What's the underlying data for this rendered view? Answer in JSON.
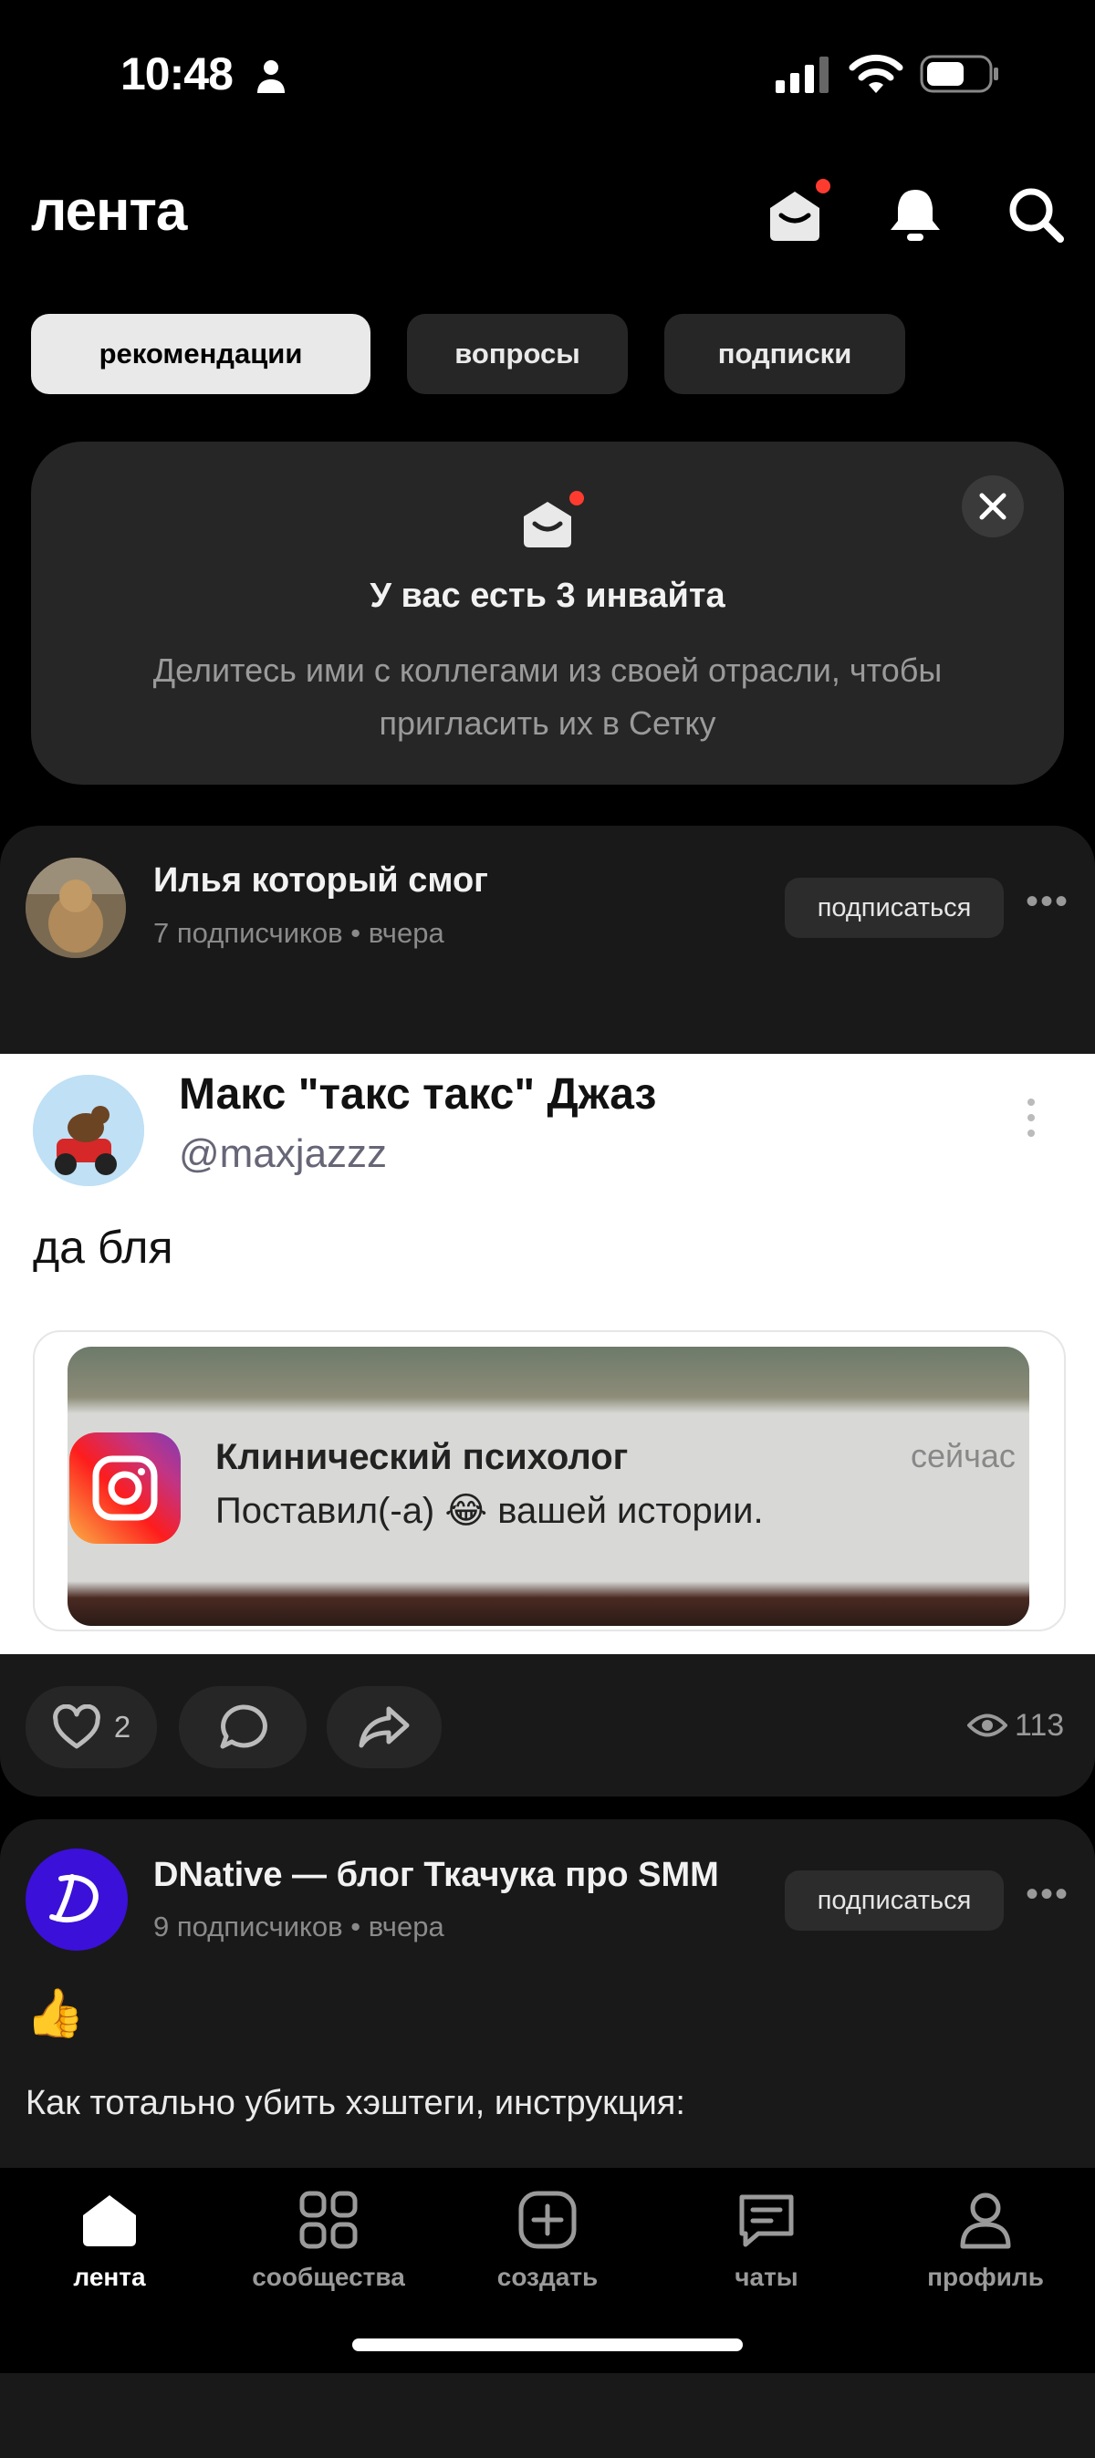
{
  "status_bar": {
    "time": "10:48"
  },
  "header": {
    "title": "лента"
  },
  "tabs": [
    {
      "label": "рекомендации",
      "active": true
    },
    {
      "label": "вопросы",
      "active": false
    },
    {
      "label": "подписки",
      "active": false
    }
  ],
  "invite_card": {
    "title": "У вас есть 3 инвайта",
    "text": "Делитесь ими с коллегами из своей отрасли, чтобы пригласить их в Сетку"
  },
  "posts": [
    {
      "author": "Илья который смог",
      "subscribers": "7 подписчиков",
      "time": "вчера",
      "subscribe_label": "подписаться",
      "embedded": {
        "name": "Макс \"такс такс\" Джаз",
        "handle": "@maxjazzz",
        "text": "да бля",
        "notification_title": "Клинический психолог",
        "notification_time": "сейчас",
        "notification_text": "Поставил(-а) 😂 вашей истории."
      },
      "likes": "2",
      "views": "113"
    },
    {
      "author": "DNative — блог Ткачука про SMM",
      "subscribers": "9 подписчиков",
      "time": "вчера",
      "subscribe_label": "подписаться",
      "emoji": "👍",
      "text": "Как тотально убить хэштеги, инструкция:"
    }
  ],
  "bottom_nav": [
    {
      "label": "лента",
      "icon": "home-icon",
      "active": true
    },
    {
      "label": "сообщества",
      "icon": "grid-icon",
      "active": false
    },
    {
      "label": "создать",
      "icon": "plus-square-icon",
      "active": false
    },
    {
      "label": "чаты",
      "icon": "chat-icon",
      "active": false
    },
    {
      "label": "профиль",
      "icon": "profile-icon",
      "active": false
    }
  ],
  "colors": {
    "accent_dot": "#ff3b30",
    "background": "#000000",
    "card": "#262626"
  }
}
